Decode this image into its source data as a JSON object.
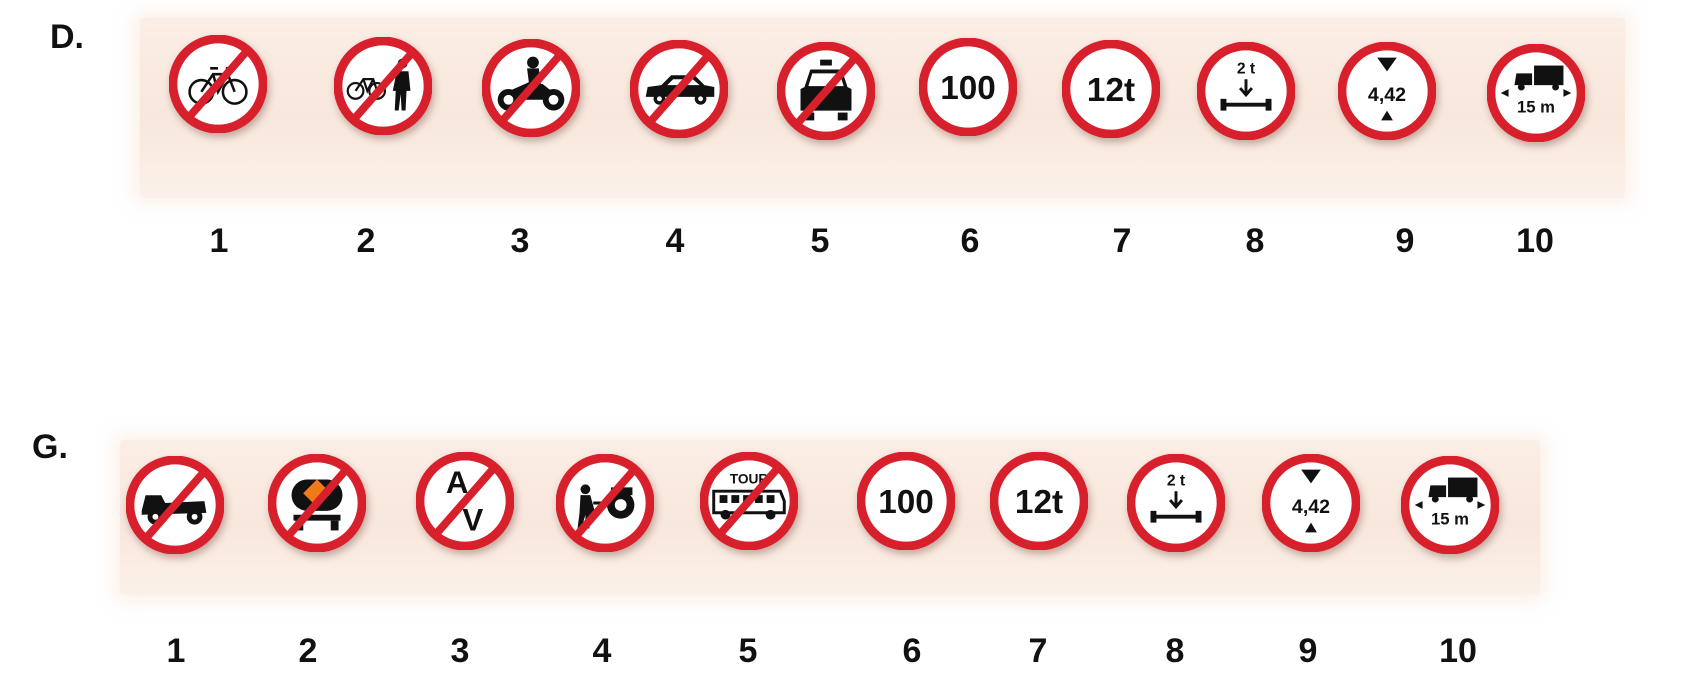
{
  "sections": [
    {
      "label": "D.",
      "signs": [
        {
          "number": "1",
          "icon": "bicycle-icon",
          "prohibition": true
        },
        {
          "number": "2",
          "icon": "bicycle-pedestrian-icon",
          "prohibition": true
        },
        {
          "number": "3",
          "icon": "motorcycle-icon",
          "prohibition": true
        },
        {
          "number": "4",
          "icon": "car-icon",
          "prohibition": true
        },
        {
          "number": "5",
          "icon": "taxi-icon",
          "prohibition": true
        },
        {
          "number": "6",
          "icon": "speed-limit-icon",
          "text": "100"
        },
        {
          "number": "7",
          "icon": "weight-limit-icon",
          "text": "12t"
        },
        {
          "number": "8",
          "icon": "axle-load-icon",
          "text": "2 t"
        },
        {
          "number": "9",
          "icon": "height-limit-icon",
          "text": "4,42"
        },
        {
          "number": "10",
          "icon": "length-limit-icon",
          "text": "15 m"
        }
      ]
    },
    {
      "label": "G.",
      "signs": [
        {
          "number": "1",
          "icon": "tractor-icon",
          "prohibition": true
        },
        {
          "number": "2",
          "icon": "dangerous-goods-tanker-icon",
          "prohibition": true
        },
        {
          "number": "3",
          "icon": "animal-drawn-vehicle-icon",
          "text": "A\nV",
          "prohibition": true
        },
        {
          "number": "4",
          "icon": "handcart-icon",
          "prohibition": true
        },
        {
          "number": "5",
          "icon": "tour-bus-icon",
          "text": "TOUR",
          "prohibition": true
        },
        {
          "number": "6",
          "icon": "speed-limit-icon",
          "text": "100"
        },
        {
          "number": "7",
          "icon": "weight-limit-icon",
          "text": "12t"
        },
        {
          "number": "8",
          "icon": "axle-load-icon",
          "text": "2 t"
        },
        {
          "number": "9",
          "icon": "height-limit-icon",
          "text": "4,42"
        },
        {
          "number": "10",
          "icon": "length-limit-icon",
          "text": "15 m"
        }
      ]
    }
  ],
  "colors": {
    "ring": "#d81f2c",
    "inner": "#ffffff",
    "symbol": "#111111",
    "strip": "#f8e7dc"
  }
}
